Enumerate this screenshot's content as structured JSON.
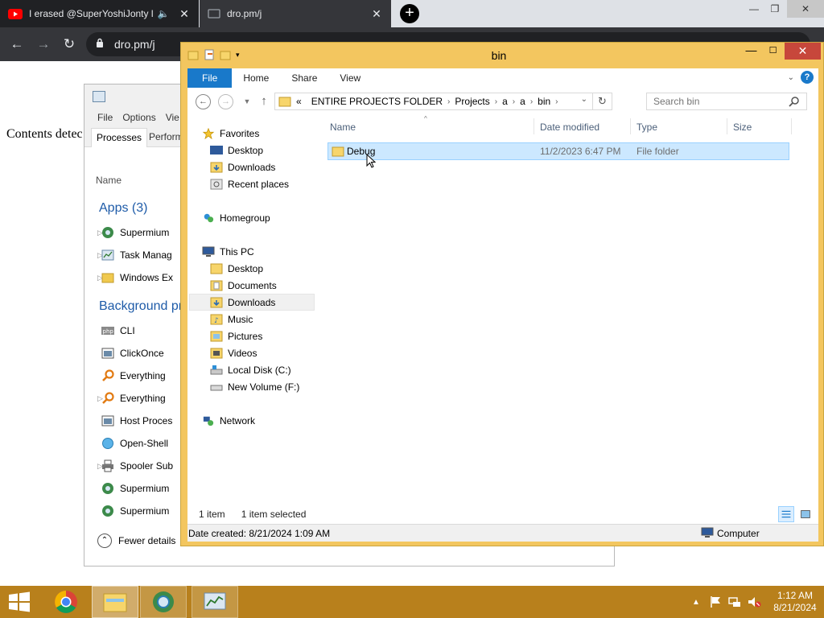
{
  "browser": {
    "tabs": [
      {
        "title": "I erased @SuperYoshiJonty l"
      },
      {
        "title": "dro.pm/j"
      }
    ],
    "url": "dro.pm/j"
  },
  "page": {
    "contents_text": "Contents detec"
  },
  "task_manager": {
    "menu": [
      "File",
      "Options",
      "Vie"
    ],
    "tabs": [
      "Processes",
      "Perform"
    ],
    "column_header": "Name",
    "apps_group": "Apps (3)",
    "apps": [
      {
        "name": "Supermium",
        "icon": "supermium-icon"
      },
      {
        "name": "Task Manag",
        "icon": "task-manager-icon"
      },
      {
        "name": "Windows Ex",
        "icon": "folder-icon"
      }
    ],
    "background_group": "Background pr",
    "background": [
      {
        "name": "CLI",
        "icon": "php-icon"
      },
      {
        "name": "ClickOnce",
        "icon": "window-icon"
      },
      {
        "name": "Everything",
        "icon": "magnifier-icon"
      },
      {
        "name": "Everything",
        "icon": "magnifier-icon"
      },
      {
        "name": "Host Proces",
        "icon": "window-icon"
      },
      {
        "name": "Open-Shell",
        "icon": "shell-icon"
      },
      {
        "name": "Spooler Sub",
        "icon": "printer-icon"
      },
      {
        "name": "Supermium",
        "icon": "supermium-icon"
      },
      {
        "name": "Supermium",
        "icon": "supermium-icon"
      }
    ],
    "footer": "Fewer details"
  },
  "explorer": {
    "title": "bin",
    "ribbon_tabs": [
      "File",
      "Home",
      "Share",
      "View"
    ],
    "breadcrumb": [
      "ENTIRE PROJECTS FOLDER",
      "Projects",
      "a",
      "a",
      "bin"
    ],
    "breadcrumb_overflow": "«",
    "search_placeholder": "Search bin",
    "nav": {
      "favorites": {
        "label": "Favorites",
        "items": [
          "Desktop",
          "Downloads",
          "Recent places"
        ]
      },
      "homegroup": "Homegroup",
      "this_pc": {
        "label": "This PC",
        "items": [
          "Desktop",
          "Documents",
          "Downloads",
          "Music",
          "Pictures",
          "Videos",
          "Local Disk (C:)",
          "New Volume (F:)"
        ]
      },
      "network": "Network"
    },
    "columns": [
      "Name",
      "Date modified",
      "Type",
      "Size"
    ],
    "files": [
      {
        "name": "Debug",
        "date": "11/2/2023 6:47 PM",
        "type": "File folder",
        "size": ""
      }
    ],
    "status": {
      "count": "1 item",
      "selected": "1 item selected"
    },
    "details": {
      "date_created": "Date created: 8/21/2024 1:09 AM",
      "location": "Computer"
    }
  },
  "taskbar": {
    "time": "1:12 AM",
    "date": "8/21/2024"
  },
  "colors": {
    "explorer_frame": "#f3c65f",
    "taskbar": "#b8801c",
    "selection": "#cce8ff",
    "file_tab": "#1979ca"
  }
}
